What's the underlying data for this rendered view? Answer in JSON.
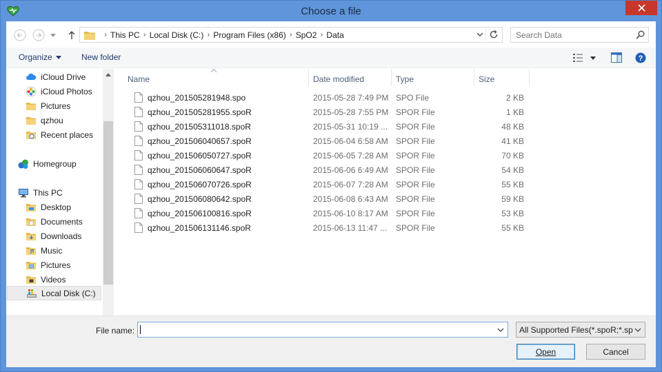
{
  "window": {
    "title": "Choose a file"
  },
  "address": {
    "crumbs": [
      "This PC",
      "Local Disk (C:)",
      "Program Files (x86)",
      "SpO2",
      "Data"
    ],
    "search_placeholder": "Search Data"
  },
  "toolbar": {
    "organize_label": "Organize",
    "new_folder_label": "New folder"
  },
  "nav": {
    "items": [
      {
        "label": "iCloud Drive",
        "icon": "icloud-icon"
      },
      {
        "label": "iCloud Photos",
        "icon": "photos-icon"
      },
      {
        "label": "Pictures",
        "icon": "folder-icon"
      },
      {
        "label": "qzhou",
        "icon": "folder-icon"
      },
      {
        "label": "Recent places",
        "icon": "recent-places-icon"
      },
      {
        "label": "Homegroup",
        "icon": "homegroup-icon"
      },
      {
        "label": "This PC",
        "icon": "computer-icon"
      },
      {
        "label": "Desktop",
        "icon": "folder-icon"
      },
      {
        "label": "Documents",
        "icon": "folder-icon"
      },
      {
        "label": "Downloads",
        "icon": "folder-icon"
      },
      {
        "label": "Music",
        "icon": "folder-icon"
      },
      {
        "label": "Pictures",
        "icon": "folder-icon"
      },
      {
        "label": "Videos",
        "icon": "folder-icon"
      },
      {
        "label": "Local Disk (C:)",
        "icon": "drive-icon"
      }
    ]
  },
  "columns": {
    "name": "Name",
    "date": "Date modified",
    "type": "Type",
    "size": "Size"
  },
  "files": [
    {
      "name": "qzhou_201505281948.spo",
      "date": "2015-05-28 7:49 PM",
      "type": "SPO File",
      "size": "2 KB"
    },
    {
      "name": "qzhou_201505281955.spoR",
      "date": "2015-05-28 7:55 PM",
      "type": "SPOR File",
      "size": "1 KB"
    },
    {
      "name": "qzhou_201505311018.spoR",
      "date": "2015-05-31 10:19 ...",
      "type": "SPOR File",
      "size": "48 KB"
    },
    {
      "name": "qzhou_201506040657.spoR",
      "date": "2015-06-04 6:58 AM",
      "type": "SPOR File",
      "size": "41 KB"
    },
    {
      "name": "qzhou_201506050727.spoR",
      "date": "2015-06-05 7:28 AM",
      "type": "SPOR File",
      "size": "70 KB"
    },
    {
      "name": "qzhou_201506060647.spoR",
      "date": "2015-06-06 6:49 AM",
      "type": "SPOR File",
      "size": "54 KB"
    },
    {
      "name": "qzhou_201506070726.spoR",
      "date": "2015-06-07 7:28 AM",
      "type": "SPOR File",
      "size": "55 KB"
    },
    {
      "name": "qzhou_201506080642.spoR",
      "date": "2015-06-08 6:43 AM",
      "type": "SPOR File",
      "size": "59 KB"
    },
    {
      "name": "qzhou_201506100816.spoR",
      "date": "2015-06-10 8:17 AM",
      "type": "SPOR File",
      "size": "53 KB"
    },
    {
      "name": "qzhou_201506131146.spoR",
      "date": "2015-06-13 11:47 ...",
      "type": "SPOR File",
      "size": "55 KB"
    }
  ],
  "footer": {
    "file_name_label": "File name:",
    "file_name_value": "",
    "filter_value": "All Supported Files(*.spoR;*.spo)",
    "open_label": "Open",
    "cancel_label": "Cancel"
  },
  "colors": {
    "frame": "#5f95da",
    "close": "#c7372b",
    "folder": "#e8b84a"
  }
}
